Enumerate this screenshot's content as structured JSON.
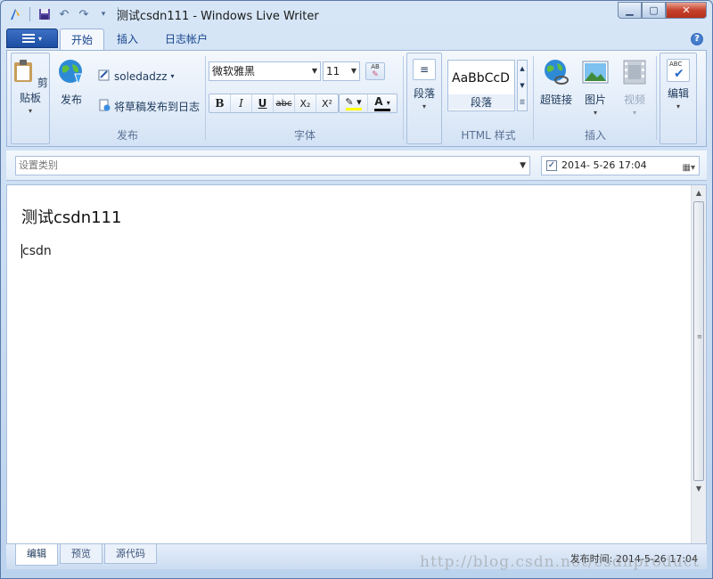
{
  "window": {
    "title": "测试csdn111 - Windows Live Writer"
  },
  "tabs": [
    {
      "label": "开始"
    },
    {
      "label": "插入"
    },
    {
      "label": "日志帐户"
    }
  ],
  "ribbon": {
    "clipboard": {
      "label": "剪贴板"
    },
    "publish_group": {
      "publish_label": "发布",
      "account_label": "soledadzz",
      "post_draft_label": "将草稿发布到日志",
      "group_label": "发布"
    },
    "font_group": {
      "font_name": "微软雅黑",
      "font_size": "11",
      "group_label": "字体",
      "bold": "B",
      "italic": "I",
      "underline": "U",
      "strike": "abc",
      "subscript": "X₂",
      "superscript": "X²",
      "font_color_letter": "A",
      "clear_format": "AB"
    },
    "paragraph": {
      "label": "段落"
    },
    "html_styles": {
      "preview": "AaBbCcD",
      "style_name": "段落",
      "group_label": "HTML 样式"
    },
    "insert_group": {
      "hyperlink": "超链接",
      "picture": "图片",
      "video": "视频",
      "group_label": "插入"
    },
    "edit": {
      "label": "编辑",
      "spell_icon_text": "ABC"
    }
  },
  "category": {
    "placeholder": "设置类别"
  },
  "date": {
    "checked": true,
    "value": "2014-  5-26 17:04"
  },
  "post": {
    "title": "测试csdn111",
    "body": "csdn"
  },
  "view_tabs": [
    {
      "label": "编辑"
    },
    {
      "label": "预览"
    },
    {
      "label": "源代码"
    }
  ],
  "status": {
    "publish_time": "发布时间: 2014-5-26 17:04"
  },
  "watermark": "http://blog.csdn.net/csdnproduct",
  "colors": {
    "accent": "#1c4ea3",
    "ribbon_text": "#1e395b",
    "close_button": "#c5412b",
    "highlight": "#ffff00",
    "font_color": "#000000"
  }
}
